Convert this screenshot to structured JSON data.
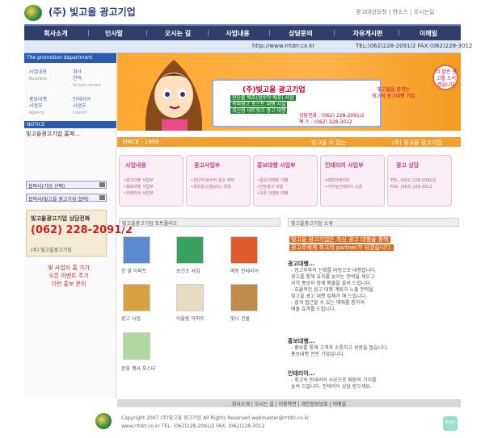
{
  "header": {
    "brand": "(주) 빛고을 광고기업",
    "top_links": "광고대상요청 | 한소스 | 오시는길"
  },
  "nav": {
    "items": [
      "회사소개",
      "인사말",
      "오시는 길",
      "사업내용",
      "상담문의",
      "자유게시판",
      "이메일"
    ]
  },
  "subbar": {
    "url": "http://www.rrtdrr.co.kr",
    "tel": "TEL:(062)228-2091/2  FAX:(062)228-3012"
  },
  "left": {
    "promo_head": "The promotion department",
    "menu": [
      {
        "ko": "사업내용",
        "en": "Business"
      },
      {
        "ko": "회사\n연혁",
        "en": "School record"
      },
      {
        "ko": "홍보대행\n사업부",
        "en": "Agency"
      },
      {
        "ko": "인테리어\n사업부",
        "en": "Interior"
      }
    ],
    "notice_head": "NOTICE",
    "notice_item": "빛고을광고기업 홈페...",
    "select1": "협력사(기업 선택)",
    "select2": "협력사(빛고을 광고기업 협력)",
    "consult_title": "빛고을광고기업 상담전화",
    "consult_phone": "(062) 228-2091/2",
    "consult_company": "(주) 빛고을광고기업",
    "links": [
      "빛 사업자 홈 가기",
      "오픈 이벤트 주기",
      "이런 홍보 문의"
    ]
  },
  "banner": {
    "card_title": "(주)빛고을 광고기업",
    "card_lines": [
      "전단물 배포(현수막 배포) 사업",
      "옥외광고 포스트 대행 시설",
      "최신형 네트워크 광고 대행"
    ],
    "card_tel": [
      "상담전화 : (062) 228-2091/2",
      "팩 스 : (062) 228-3012"
    ],
    "card_right": [
      "빛고을을 밝히는",
      "최고의 광고대행 기업"
    ],
    "bubble": "더 많은 광고를 드리겠습니다"
  },
  "since_bar": {
    "left": "SINCE : 1998",
    "mid": "빛고을 수 있는",
    "right": "(주) 빛고을 광고기업"
  },
  "boxes": [
    {
      "title": "사업내용",
      "lines": [
        "•광고대행 사업부",
        "•홍보대행 사업부",
        "•인테리어 사업부"
      ]
    },
    {
      "title": "광고사업부",
      "lines": [
        "•전단지/현수막 광고 제작",
        "•옥외광고(빌보드) 대행"
      ]
    },
    {
      "title": "홍보대행 사업부",
      "lines": [
        "•홍보/이벤트 대행",
        "•간판광고 대행",
        "•오픈 이벤트 대행"
      ]
    },
    {
      "title": "인테리어 사업부",
      "lines": [
        "•매장인테리어",
        "•사무실인테리어 시공"
      ]
    },
    {
      "title": "광고 상담",
      "lines": [
        "TEL: (062) 228-2091/2",
        "FAX: (062) 228-3012"
      ]
    }
  ],
  "portfolio": {
    "head": "빛고을광고기업 포트폴리오",
    "items": [
      "한 빛 아파트",
      "보건소 사업",
      "매장 인테리어",
      "광고 사업",
      "어울림 아파트",
      "빛나 건물",
      "문화 행사 포스터"
    ]
  },
  "textpanel": {
    "head": "빛고을광고기업 소개",
    "highlight": [
      "빛고을 광고기업은 최신 광고 대행을 통해",
      "광고주에게 최고의 partner가 되겠습니다."
    ],
    "section1_title": "광고대행...",
    "section1": [
      "- 광고주와의 신뢰를 바탕으로 대행합니다.",
      "  광고를 통해 효과를 높이는 전략을 세우고",
      "  지역 홍보와 함께 매출을 올려 드립니다.",
      "- 효율적인 광고 대행 계획과 노출 전략을",
      "  빛고을 광고 대행 업체가 해 드립니다.",
      "- 쉽게 접근할 수 있는 매체를 통하여",
      "  매출 효과를 드립니다."
    ],
    "section2_title": "홍보대행...",
    "section2": [
      "- 홍보를 통해 고객과 소통하고 성장을 돕습니다.",
      "  홍보대행 전문 기업입니다."
    ],
    "section3_title": "인테리어...",
    "section3": [
      "- 최고의 인테리어 시공으로 매장의 가치를",
      "  높여 드립니다. 인테리어 상담 받으세요."
    ]
  },
  "footer": {
    "bar": "회사소개 | 오시는 길 | 이용약관 | 개인정보보호 | 이메일",
    "copyright": "Copyright 2007 (주)빛고을 광고기업 All Rights Reserved  webmaster@rrtdrr.co.kr",
    "contact": "www.rrtdrr.co.kr   TEL: (062)228-2091/2   FAX: (062)228-3012",
    "top_btn": "TOP"
  }
}
